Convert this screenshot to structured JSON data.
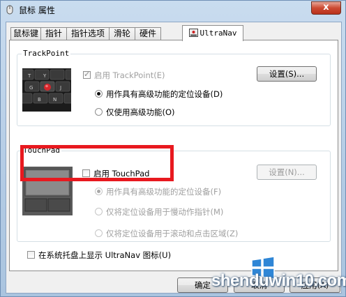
{
  "window": {
    "title": "鼠标 属性",
    "close_label": "x"
  },
  "tabs": [
    {
      "label": "鼠标键"
    },
    {
      "label": "指针"
    },
    {
      "label": "指针选项"
    },
    {
      "label": "滑轮"
    },
    {
      "label": "硬件"
    },
    {
      "label": "UltraNav"
    }
  ],
  "trackpoint": {
    "group_label": "TrackPoint",
    "enable_label": "启用 TrackPoint(E)",
    "enable_checked": true,
    "settings_label": "设置(S)...",
    "options": [
      {
        "label": "用作具有高级功能的定位设备(D)",
        "checked": true
      },
      {
        "label": "仅使用高级功能(O)",
        "checked": false
      }
    ]
  },
  "touchpad": {
    "group_label": "TouchPad",
    "enable_label": "启用 TouchPad",
    "enable_checked": false,
    "settings_label": "设置(N)...",
    "options": [
      {
        "label": "用作具有高级功能的定位设备(F)",
        "checked": true
      },
      {
        "label": "仅将定位设备用于慢动作指针(M)",
        "checked": false
      },
      {
        "label": "仅将定位设备用于滚动和点击区域(Z)",
        "checked": false
      }
    ]
  },
  "tray": {
    "label": "在系统托盘上显示 UltraNav 图标(U)",
    "checked": false
  },
  "footer": {
    "ok_label": "确定",
    "cancel_label": "取消",
    "apply_label": "应用(A)"
  },
  "watermark": {
    "text": "shenduwin10.com"
  },
  "colors": {
    "highlight": "#e8191f"
  }
}
